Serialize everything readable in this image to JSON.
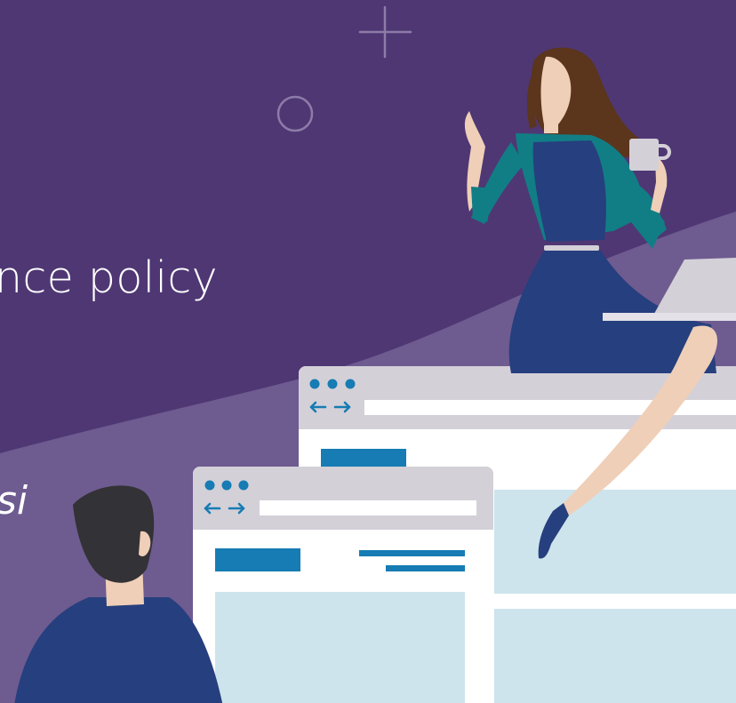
{
  "banner": {
    "headline": "nce policy",
    "subline": "si"
  },
  "colors": {
    "background": "#4f3774",
    "wave": "#6e5b90",
    "window_bar": "#d4d0d8",
    "window_body": "#ffffff",
    "accent_blue": "#167cb3",
    "light_panel": "#cde4ec",
    "dress_navy": "#263f7e",
    "cardigan_teal": "#117e85",
    "hair_brown": "#5b351c",
    "skin": "#efcfb8",
    "man_hair": "#333236",
    "mug": "#d4d0d8",
    "laptop": "#d4d0d8"
  },
  "icons": {
    "plus": "plus-icon",
    "circle": "circle-outline-icon",
    "window_dots": "window-dots-icon",
    "nav_arrows": "nav-arrows-icon"
  }
}
